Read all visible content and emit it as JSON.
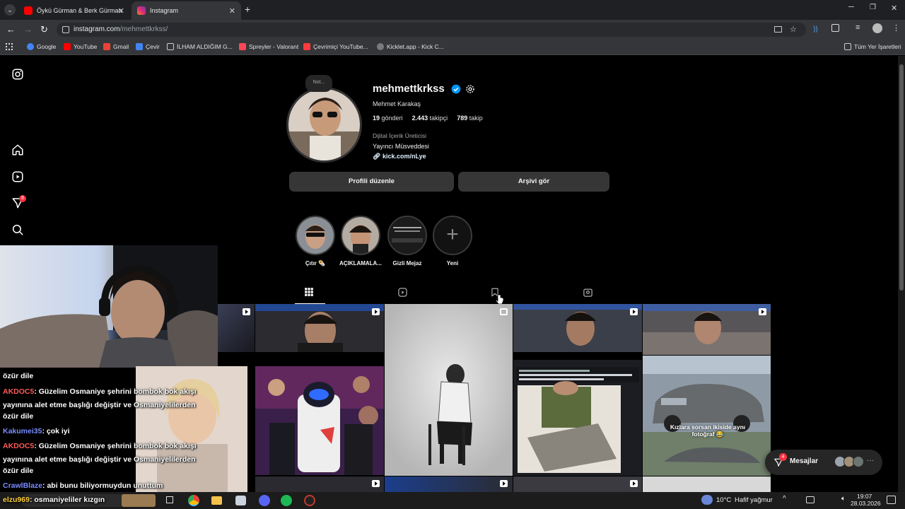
{
  "browser": {
    "tabs": [
      {
        "title": "Öykü Gürman & Berk Gürman",
        "favicon_color": "#ff0000"
      },
      {
        "title": "Instagram",
        "favicon_color": "#d62976"
      }
    ],
    "new_tab": "+",
    "url_host": "instagram.com",
    "url_path": "/mehmettkrkss/",
    "bookmarks": [
      {
        "label": "Google",
        "color": "#4285f4"
      },
      {
        "label": "YouTube",
        "color": "#ff0000"
      },
      {
        "label": "Gmail",
        "color": "#ea4335"
      },
      {
        "label": "Çevir",
        "color": "#4285f4"
      },
      {
        "label": "İLHAM ALDIĞIM G...",
        "color": "#cccccc"
      },
      {
        "label": "Spreyler - Valorant",
        "color": "#ff4655"
      },
      {
        "label": "Çevrimiçi YouTube...",
        "color": "#ff3b3b"
      },
      {
        "label": "Kicklet.app - Kick C...",
        "color": "#7a7a7a"
      }
    ],
    "all_bookmarks": "Tüm Yer İşaretleri"
  },
  "sidebar": {
    "notification_count": "8"
  },
  "profile": {
    "note": "Not...",
    "username": "mehmettkrkss",
    "full_name": "Mehmet Karakaş",
    "posts_count": "19",
    "posts_label": "gönderi",
    "followers_count": "2.443",
    "followers_label": "takipçi",
    "following_count": "789",
    "following_label": "takip",
    "category": "Dijital İçerik Üreticisi",
    "bio": "Yayıncı Müsveddesi",
    "link": "kick.com/nLye",
    "edit_button": "Profili düzenle",
    "archive_button": "Arşivi gör"
  },
  "highlights": [
    {
      "label": "Çıtır 🌯"
    },
    {
      "label": "AÇIKLAMALA..."
    },
    {
      "label": "Gizli Mejaz"
    },
    {
      "label": "Yeni"
    }
  ],
  "grid": {
    "post_caption": "Kızlara sorsan ikiside aynı fotoğraf 😂"
  },
  "messages": {
    "label": "Mesajlar",
    "badge": "4"
  },
  "overlay": {
    "chat": [
      {
        "user": "",
        "text": "özür dile"
      },
      {
        "user": "AKDOC5",
        "text": ": Güzelim Osmaniye şehrini bombok bok akışı"
      },
      {
        "user": "",
        "text": "yayınına alet etme başlığı değiştir ve Osmaniyelilerden"
      },
      {
        "user": "",
        "text": "özür dile"
      },
      {
        "user": "Kakumei35",
        "text": ": çok iyi"
      },
      {
        "user": "AKDOC5",
        "text": ": Güzelim Osmaniye şehrini bombok bok akışı"
      },
      {
        "user": "",
        "text": "yayınına alet etme başlığı değiştir ve Osmaniyelilerden"
      },
      {
        "user": "",
        "text": "özür dile"
      },
      {
        "user": "CrawlBlaze",
        "text": ": abi bunu biliyormuydun unuttum"
      },
      {
        "user": "elzu969",
        "text": ": osmaniyeliler kızgın"
      }
    ]
  },
  "taskbar": {
    "weather_temp": "10°C",
    "weather_desc": "Hafif yağmur",
    "time": "19:07",
    "date": "28.03.2026"
  }
}
